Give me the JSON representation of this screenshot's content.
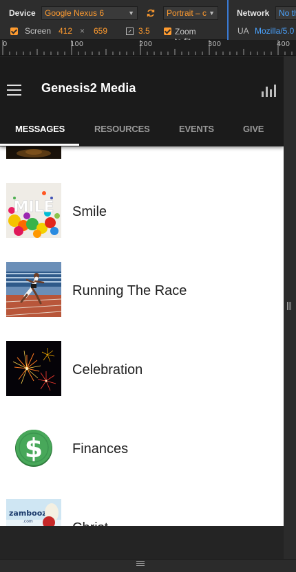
{
  "devtools": {
    "device_label": "Device",
    "device_select": "Google Nexus 6",
    "orientation_select": "Portrait – c",
    "screen_label": "Screen",
    "screen_width": "412",
    "times": "×",
    "screen_height": "659",
    "dpr": "3.5",
    "zoom_to_fit_label": "Zoom to fit",
    "network_label": "Network",
    "network_value": "No th",
    "ua_label": "UA",
    "ua_value": "Mozilla/5.0"
  },
  "ruler": {
    "labels": [
      "0",
      "100",
      "200",
      "300",
      "400"
    ]
  },
  "app": {
    "title": "Genesis2 Media",
    "tabs": [
      {
        "label": "MESSAGES",
        "active": true
      },
      {
        "label": "RESOURCES",
        "active": false
      },
      {
        "label": "EVENTS",
        "active": false
      },
      {
        "label": "GIVE",
        "active": false
      }
    ],
    "items": [
      {
        "title": "",
        "thumb": "dark-photo"
      },
      {
        "title": "Smile",
        "thumb": "smile-art"
      },
      {
        "title": "Running The Race",
        "thumb": "runner-photo"
      },
      {
        "title": "Celebration",
        "thumb": "fireworks-photo"
      },
      {
        "title": "Finances",
        "thumb": "dollar-icon"
      },
      {
        "title": "Christ...",
        "thumb": "zamboozle-logo"
      }
    ]
  },
  "colors": {
    "devtools_bg": "#2d2d2d",
    "devtools_accent": "#ff9b2f",
    "devtools_blue": "#4aa3ff",
    "appbar_bg": "#1b1b1b",
    "list_bg": "#ffffff",
    "finance_green": "#3f8f4e"
  }
}
